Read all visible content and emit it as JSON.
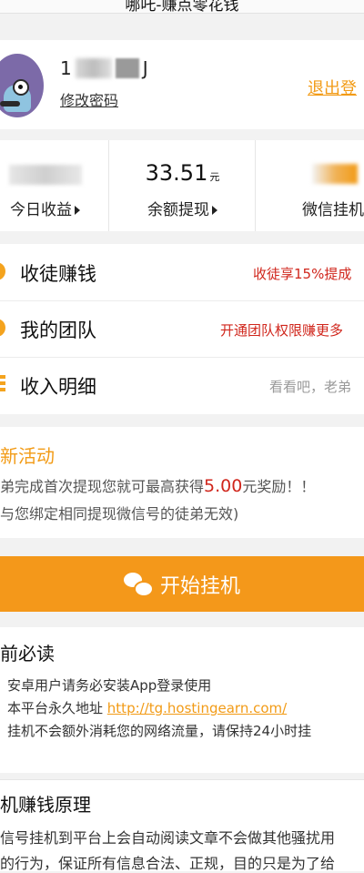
{
  "header": {
    "title": "哪吒-赚点零花钱"
  },
  "profile": {
    "phone_visible": "1",
    "phone_suffix": "J",
    "change_password": "修改密码",
    "logout": "退出登"
  },
  "stats": [
    {
      "value": "",
      "label": "今日收益"
    },
    {
      "value": "33.51",
      "unit": "元",
      "label": "余额提现"
    },
    {
      "value": "",
      "label": "微信挂机"
    }
  ],
  "menu": [
    {
      "label": "收徒赚钱",
      "hint": "收徒享15%提成"
    },
    {
      "label": "我的团队",
      "hint": "开通团队权限赚更多"
    },
    {
      "label": "收入明细",
      "hint": "看看吧，老弟"
    }
  ],
  "activity": {
    "title": "新活动",
    "line1_prefix": "弟完成首次提现您就可最高获得",
    "line1_amount": "5.00",
    "line1_suffix": "元奖励！！",
    "line2": "与您绑定相同提现微信号的徒弟无效)"
  },
  "start_button": {
    "label": "开始挂机",
    "icon": "wechat-icon"
  },
  "notice": {
    "title": "前必读",
    "item1": "安卓用户请务必安装App登录使用",
    "item2_prefix": "本平台永久地址",
    "item2_link": "http://tg.hostingearn.com/",
    "item3": "挂机不会额外消耗您的网络流量，请保持24小时挂"
  },
  "principle": {
    "title": "机赚钱原理",
    "line1": "信号挂机到平台上会自动阅读文章不会做其他骚扰用",
    "line2": "的行为，保证所有信息合法、正规，目的只是为了给"
  },
  "colors": {
    "accent": "#f29b16",
    "button": "#f4981a",
    "red": "#d0261c"
  }
}
